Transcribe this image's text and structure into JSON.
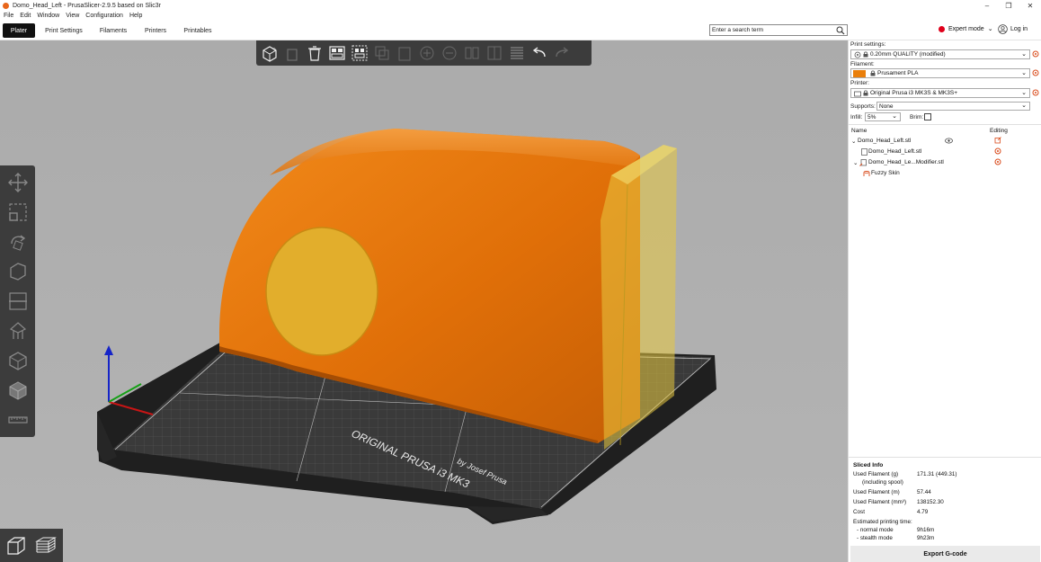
{
  "window": {
    "title": "Domo_Head_Left - PrusaSlicer-2.9.5 based on Slic3r",
    "minimize": "–",
    "maximize": "❐",
    "close": "✕"
  },
  "menu": [
    "File",
    "Edit",
    "Window",
    "View",
    "Configuration",
    "Help"
  ],
  "tabs": [
    "Plater",
    "Print Settings",
    "Filaments",
    "Printers",
    "Printables"
  ],
  "search": {
    "placeholder": "Enter a search term",
    "value": "Enter a search term"
  },
  "mode": {
    "label": "Expert mode",
    "color": "#e0001b"
  },
  "login": {
    "label": "Log in"
  },
  "bed": {
    "line1": "ORIGINAL PRUSA i3 MK3",
    "line2": "by Josef Prusa"
  },
  "panel": {
    "print_settings_label": "Print settings:",
    "print_settings_value": "0.20mm QUALITY (modified)",
    "filament_label": "Filament:",
    "filament_value": "Prusament PLA",
    "filament_color": "#ea7f0b",
    "printer_label": "Printer:",
    "printer_value": "Original Prusa i3 MK3S & MK3S+",
    "supports_label": "Supports:",
    "supports_value": "None",
    "infill_label": "Infill:",
    "infill_value": "5%",
    "brim_label": "Brim:",
    "col_name": "Name",
    "col_editing": "Editing",
    "tree": [
      "Domo_Head_Left.stl",
      "Domo_Head_Left.stl",
      "Domo_Head_Le...Modifier.stl",
      "Fuzzy Skin"
    ]
  },
  "sliced": {
    "title": "Sliced Info",
    "rows": [
      {
        "label": "Used Filament (g)",
        "value": "171.31 (449.31)"
      },
      {
        "label": "(including spool)",
        "value": ""
      },
      {
        "label": "Used Filament (m)",
        "value": "57.44"
      },
      {
        "label": "Used Filament (mm³)",
        "value": "138152.30"
      },
      {
        "label": "Cost",
        "value": "4.79"
      },
      {
        "label": "Estimated printing time:",
        "value": ""
      },
      {
        "label": "- normal mode",
        "value": "9h16m"
      },
      {
        "label": "- stealth mode",
        "value": "9h23m"
      }
    ]
  },
  "export_label": "Export G-code"
}
